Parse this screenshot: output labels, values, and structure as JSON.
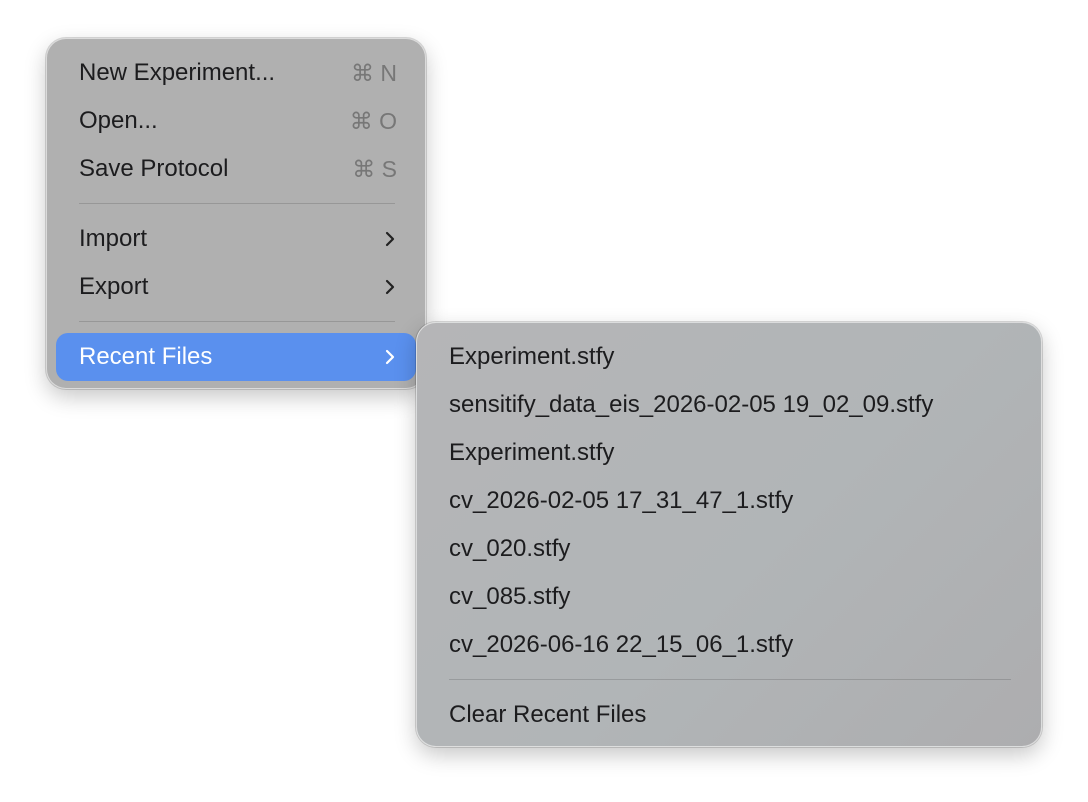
{
  "main_menu": {
    "items": [
      {
        "label": "New Experiment...",
        "shortcut": "⌘ N"
      },
      {
        "label": "Open...",
        "shortcut": "⌘ O"
      },
      {
        "label": "Save Protocol",
        "shortcut": "⌘ S"
      },
      {
        "label": "Import"
      },
      {
        "label": "Export"
      },
      {
        "label": "Recent Files"
      }
    ],
    "highlight_color": "#5a90ee"
  },
  "recent_files": {
    "files": [
      "Experiment.stfy",
      "sensitify_data_eis_2026-02-05 19_02_09.stfy",
      "Experiment.stfy",
      "cv_2026-02-05 17_31_47_1.stfy",
      "cv_020.stfy",
      "cv_085.stfy",
      "cv_2026-06-16 22_15_06_1.stfy"
    ],
    "clear_label": "Clear Recent Files"
  }
}
